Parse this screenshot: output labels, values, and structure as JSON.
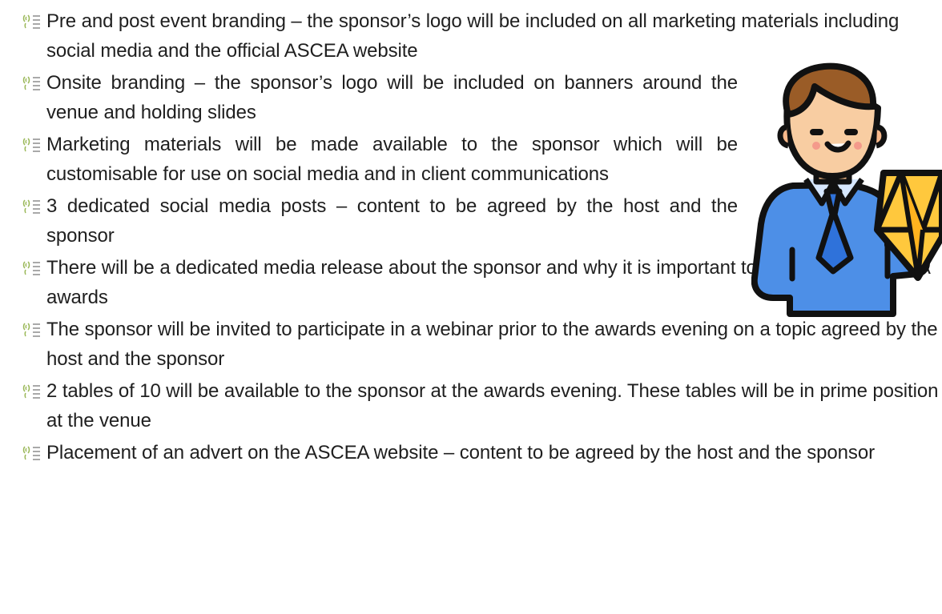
{
  "bullets": [
    {
      "text": "Pre and post event branding – the sponsor’s logo will be included on all marketing materials including social media and the official ASCEA website"
    },
    {
      "text": "Onsite branding – the sponsor’s logo will be included on banners around the venue and holding slides"
    },
    {
      "text": "Marketing materials will be made available to the sponsor which will be customisable for use on social media and in client communications"
    },
    {
      "text": "3 dedicated social media posts – content to be agreed by the host and the sponsor"
    },
    {
      "text": "There will be a dedicated media release about the sponsor and why it is important to sponsor the ASCEA awards"
    },
    {
      "text": "The sponsor will be invited to participate in a webinar prior to the awards evening on a topic agreed by the host and the sponsor"
    },
    {
      "text": "2 tables of 10 will be available to the sponsor at the awards evening.  These tables will be in prime position at the venue"
    },
    {
      "text": "Placement of an advert on the ASCEA website – content to be agreed by the host and the sponsor"
    }
  ],
  "icons": {
    "bullet": "fingerprint-list-icon",
    "illustration": "businessman-with-diamond-icon"
  },
  "colors": {
    "text": "#1f1f1f",
    "bullet_icon": "#8fb84a",
    "shirt": "#4f8fe8",
    "diamond": "#ffc83d"
  }
}
